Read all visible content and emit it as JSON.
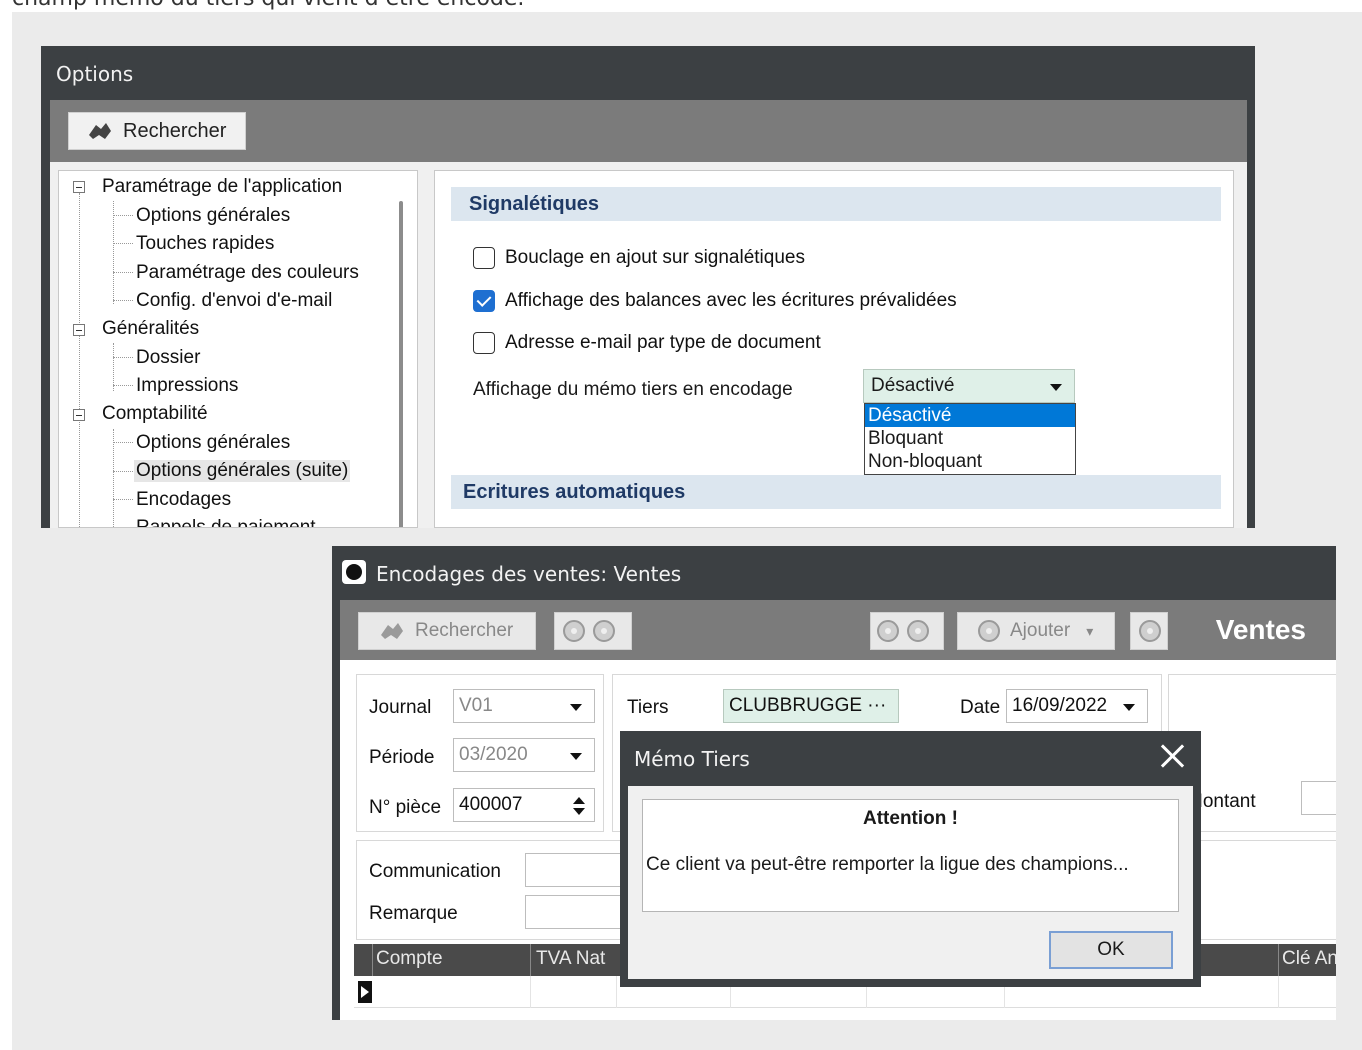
{
  "caption": "champ mémo du tiers qui vient d’être encodé.",
  "options": {
    "title": "Options",
    "search_label": "Rechercher",
    "tree": {
      "root1": "Paramétrage de l'application",
      "child1_1": "Options générales",
      "child1_2": "Touches rapides",
      "child1_3": "Paramétrage des couleurs",
      "child1_4": "Config. d'envoi d'e-mail",
      "root2": "Généralités",
      "child2_1": "Dossier",
      "child2_2": "Impressions",
      "root3": "Comptabilité",
      "child3_1": "Options générales",
      "child3_2": "Options générales (suite)",
      "child3_3": "Encodages",
      "child3_4": "Rappels de paiement"
    },
    "section1": "Signalétiques",
    "check1": "Bouclage en ajout sur signalétiques",
    "check2": "Affichage des balances avec les écritures prévalidées",
    "check3": "Adresse e-mail par type de document",
    "memo_label": "Affichage du mémo tiers en encodage",
    "memo_value": "Désactivé",
    "dropdown": {
      "opt1": "Désactivé",
      "opt2": "Bloquant",
      "opt3": "Non-bloquant"
    },
    "section2": "Ecritures automatiques"
  },
  "ventes": {
    "title": "Encodages des ventes:  Ventes",
    "search_label": "Rechercher",
    "add_label": "Ajouter",
    "header_title": "Ventes",
    "journal_label": "Journal",
    "journal_value": "V01",
    "periode_label": "Période",
    "periode_value": "03/2020",
    "piece_label": "N° pièce",
    "piece_value": "400007",
    "tiers_label": "Tiers",
    "tiers_value": "CLUBBRUGGE ···",
    "date_label": "Date",
    "date_value": "16/09/2022",
    "montant_label": "Montant",
    "communication_label": "Communication",
    "remarque_label": "Remarque",
    "grid": {
      "col1": "Compte",
      "col2": "TVA Nat",
      "col3": "Clé An"
    }
  },
  "memo_dialog": {
    "title": "Mémo Tiers",
    "heading": "Attention !",
    "message": "Ce client va peut-être remporter la ligue des champions...",
    "ok_label": "OK"
  }
}
